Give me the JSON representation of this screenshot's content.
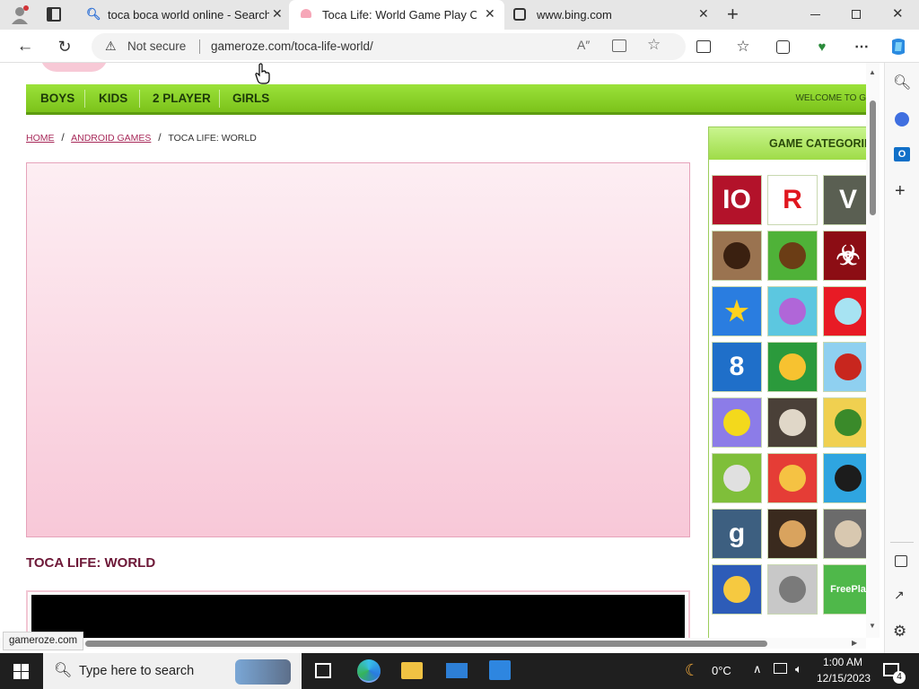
{
  "browser": {
    "tabs": [
      {
        "title": "toca boca world online - Search",
        "icon": "bing-search-icon"
      },
      {
        "title": "Toca Life: World Game Play Onlin",
        "icon": "gameroze-favicon"
      },
      {
        "title": "www.bing.com",
        "icon": "bing-favicon"
      }
    ],
    "new_tab": "+",
    "security_label": "Not secure",
    "url": "gameroze.com/toca-life-world/",
    "status_url": "gameroze.com"
  },
  "page": {
    "nav": {
      "items": [
        "BOYS",
        "KIDS",
        "2 PLAYER",
        "GIRLS"
      ],
      "welcome": "WELCOME TO G"
    },
    "breadcrumb": {
      "home": "HOME",
      "sep1": "/",
      "category": "ANDROID GAMES",
      "sep2": "/",
      "current": "TOCA LIFE: WORLD"
    },
    "game_title": "TOCA LIFE: WORLD",
    "categories": {
      "heading": "GAME CATEGORIE",
      "thumbs": [
        {
          "name": "thumb-io-games",
          "bg": "#b3122a",
          "fg": "#ffffff",
          "text": "IO"
        },
        {
          "name": "thumb-roblox",
          "bg": "#ffffff",
          "fg": "#e0161e",
          "text": "R"
        },
        {
          "name": "thumb-gta",
          "bg": "#5a5f52",
          "fg": "#ffffff",
          "text": "V"
        },
        {
          "name": "thumb-hello-neighbor",
          "bg": "#9a7350",
          "fg": "#3a2010",
          "text": ""
        },
        {
          "name": "thumb-minecraft",
          "bg": "#4fb238",
          "fg": "#6b3d15",
          "text": ""
        },
        {
          "name": "thumb-biohazard",
          "bg": "#8c0d14",
          "fg": "#ffffff",
          "text": "☣"
        },
        {
          "name": "thumb-brawl-stars",
          "bg": "#2a7de0",
          "fg": "#ffd21e",
          "text": "★"
        },
        {
          "name": "thumb-anime-girl",
          "bg": "#5cc7e0",
          "fg": "#b066d8",
          "text": ""
        },
        {
          "name": "thumb-among-us",
          "bg": "#e81b25",
          "fg": "#a7e3f2",
          "text": ""
        },
        {
          "name": "thumb-8-ball-pool",
          "bg": "#1f6fc9",
          "fg": "#ffffff",
          "text": "8"
        },
        {
          "name": "thumb-candy-match",
          "bg": "#2b9a3c",
          "fg": "#f7c230",
          "text": ""
        },
        {
          "name": "thumb-hill-climb",
          "bg": "#8fd0f0",
          "fg": "#c8261e",
          "text": ""
        },
        {
          "name": "thumb-fall-runner",
          "bg": "#8c7ce8",
          "fg": "#f3d91c",
          "text": ""
        },
        {
          "name": "thumb-evil-nun",
          "bg": "#4a4038",
          "fg": "#e0d7c8",
          "text": ""
        },
        {
          "name": "thumb-bloons",
          "bg": "#f0d050",
          "fg": "#3a8a2a",
          "text": ""
        },
        {
          "name": "thumb-tower-defense",
          "bg": "#7fbf3a",
          "fg": "#e0e0e0",
          "text": ""
        },
        {
          "name": "thumb-kick-buddy",
          "bg": "#e53d36",
          "fg": "#f5c243",
          "text": ""
        },
        {
          "name": "thumb-fnf",
          "bg": "#2fa5e0",
          "fg": "#1c1c1c",
          "text": ""
        },
        {
          "name": "thumb-gmod",
          "bg": "#3d5f80",
          "fg": "#ffffff",
          "text": "g"
        },
        {
          "name": "thumb-fnaf",
          "bg": "#3a2a1e",
          "fg": "#d9a35e",
          "text": ""
        },
        {
          "name": "thumb-granny",
          "bg": "#6b6b6b",
          "fg": "#d8c8b0",
          "text": ""
        },
        {
          "name": "thumb-clash-royale",
          "bg": "#2d5cb8",
          "fg": "#f6c940",
          "text": ""
        },
        {
          "name": "thumb-talking-tom",
          "bg": "#c8c8c8",
          "fg": "#7a7a7a",
          "text": ""
        },
        {
          "name": "thumb-freeplay",
          "bg": "#4fb84a",
          "fg": "#ffffff",
          "text": "FreePla"
        }
      ]
    }
  },
  "taskbar": {
    "search_placeholder": "Type here to search",
    "weather_temp": "0°C",
    "time": "1:00 AM",
    "date": "12/15/2023",
    "notification_count": "4"
  }
}
